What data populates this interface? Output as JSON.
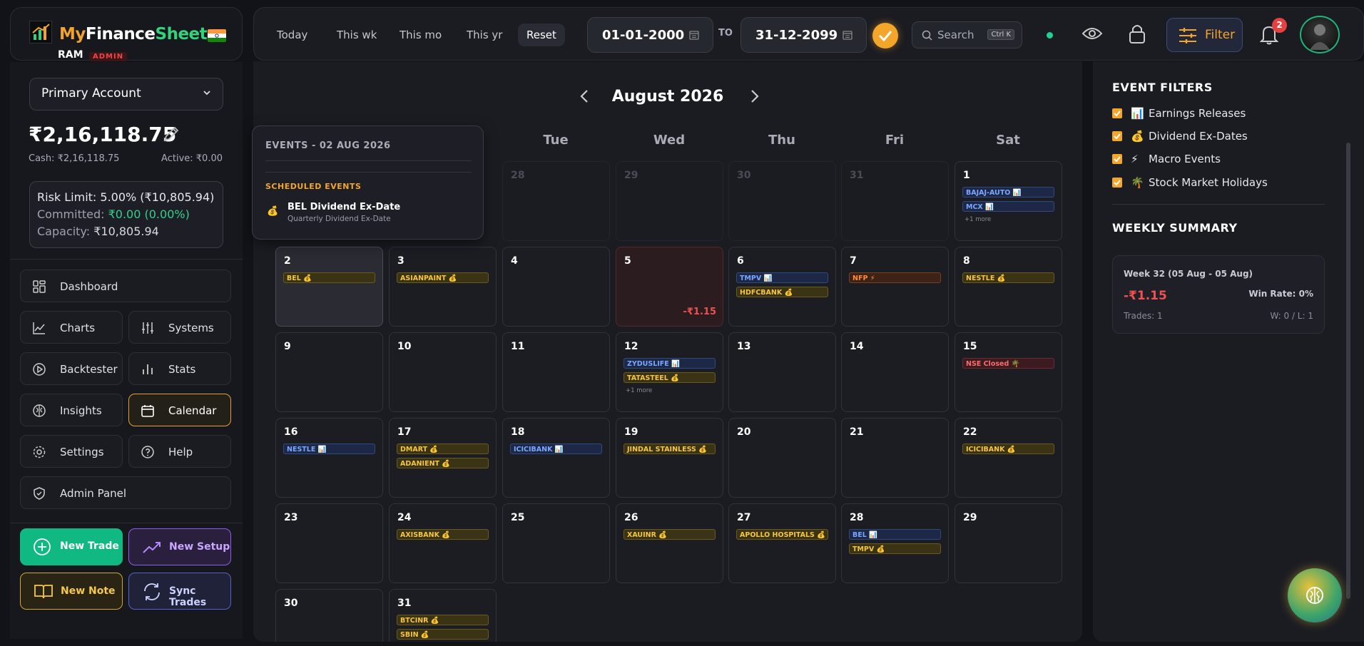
{
  "brand": {
    "name_a": "My",
    "name_b": "Finance",
    "name_c": "Sheet",
    "user": "RAM",
    "role": "ADMIN"
  },
  "account": {
    "selected": "Primary Account",
    "balance": "₹2,16,118.75",
    "cash": "Cash: ₹2,16,118.75",
    "active": "Active: ₹0.00",
    "risk_limit": "Risk Limit: 5.00% (₹10,805.94)",
    "committed_label": "Committed: ",
    "committed_value": "₹0.00 (0.00%)",
    "capacity_label": "Capacity: ",
    "capacity_value": "₹10,805.94"
  },
  "nav": {
    "dashboard": "Dashboard",
    "charts": "Charts",
    "systems": "Systems",
    "backtester": "Backtester",
    "stats": "Stats",
    "insights": "Insights",
    "calendar": "Calendar",
    "settings": "Settings",
    "help": "Help",
    "admin": "Admin Panel"
  },
  "actions": {
    "new_trade": "New Trade",
    "new_setup": "New Setup",
    "new_note": "New Note",
    "sync": "Sync Trades"
  },
  "topbar": {
    "today": "Today",
    "week": "This wk",
    "month": "This mo",
    "year": "This yr",
    "reset": "Reset",
    "from": "01-01-2000",
    "to_label": "TO",
    "to": "31-12-2099",
    "search": "Search",
    "search_kbd": "Ctrl K",
    "filter": "Filter",
    "notif_count": "2"
  },
  "calendar": {
    "month": "August 2026",
    "days_of_week": [
      "Tue",
      "Wed",
      "Thu",
      "Fri",
      "Sat"
    ],
    "prev_days": [
      "28",
      "29",
      "30",
      "31"
    ]
  },
  "popup": {
    "header": "EVENTS - 02 AUG 2026",
    "section": "SCHEDULED EVENTS",
    "event_title": "BEL Dividend Ex-Date",
    "event_sub": "Quarterly Dividend Ex-Date"
  },
  "days": {
    "d1": {
      "n": "1",
      "c1": "BAJAJ-AUTO 📊",
      "c2": "MCX 📊",
      "more": "+1 more"
    },
    "d2": {
      "n": "2",
      "c1": "BEL 💰"
    },
    "d3": {
      "n": "3",
      "c1": "ASIANPAINT 💰"
    },
    "d4": {
      "n": "4"
    },
    "d5": {
      "n": "5",
      "pnl": "-₹1.15"
    },
    "d6": {
      "n": "6",
      "c1": "TMPV 📊",
      "c2": "HDFCBANK 💰"
    },
    "d7": {
      "n": "7",
      "c1": "NFP ⚡"
    },
    "d8": {
      "n": "8",
      "c1": "NESTLE 💰"
    },
    "d9": {
      "n": "9"
    },
    "d10": {
      "n": "10"
    },
    "d11": {
      "n": "11"
    },
    "d12": {
      "n": "12",
      "c1": "ZYDUSLIFE 📊",
      "c2": "TATASTEEL 💰",
      "more": "+1 more"
    },
    "d13": {
      "n": "13"
    },
    "d14": {
      "n": "14"
    },
    "d15": {
      "n": "15",
      "c1": "NSE Closed 🌴"
    },
    "d16": {
      "n": "16",
      "c1": "NESTLE 📊"
    },
    "d17": {
      "n": "17",
      "c1": "DMART 💰",
      "c2": "ADANIENT 💰"
    },
    "d18": {
      "n": "18",
      "c1": "ICICIBANK 📊"
    },
    "d19": {
      "n": "19",
      "c1": "JINDAL STAINLESS 💰"
    },
    "d20": {
      "n": "20"
    },
    "d21": {
      "n": "21"
    },
    "d22": {
      "n": "22",
      "c1": "ICICIBANK 💰"
    },
    "d23": {
      "n": "23"
    },
    "d24": {
      "n": "24",
      "c1": "AXISBANK 💰"
    },
    "d25": {
      "n": "25"
    },
    "d26": {
      "n": "26",
      "c1": "XAUINR 💰"
    },
    "d27": {
      "n": "27",
      "c1": "APOLLO HOSPITALS 💰"
    },
    "d28": {
      "n": "28",
      "c1": "BEL 📊",
      "c2": "TMPV 💰"
    },
    "d29": {
      "n": "29"
    },
    "d30": {
      "n": "30"
    },
    "d31": {
      "n": "31",
      "c1": "BTCINR 💰",
      "c2": "SBIN 💰"
    }
  },
  "filters": {
    "title": "EVENT FILTERS",
    "items": [
      {
        "emoji": "📊",
        "label": "Earnings Releases"
      },
      {
        "emoji": "💰",
        "label": "Dividend Ex-Dates"
      },
      {
        "emoji": "⚡",
        "label": "Macro Events"
      },
      {
        "emoji": "🌴",
        "label": "Stock Market Holidays"
      }
    ]
  },
  "weekly": {
    "title": "WEEKLY SUMMARY",
    "week": "Week 32 (05 Aug - 05 Aug)",
    "pnl": "-₹1.15",
    "win_rate": "Win Rate: 0%",
    "trades": "Trades: 1",
    "wl": "W: 0 / L: 1"
  },
  "colors": {
    "accent": "#f4a62a",
    "green": "#10b981",
    "loss": "#f0504f"
  }
}
